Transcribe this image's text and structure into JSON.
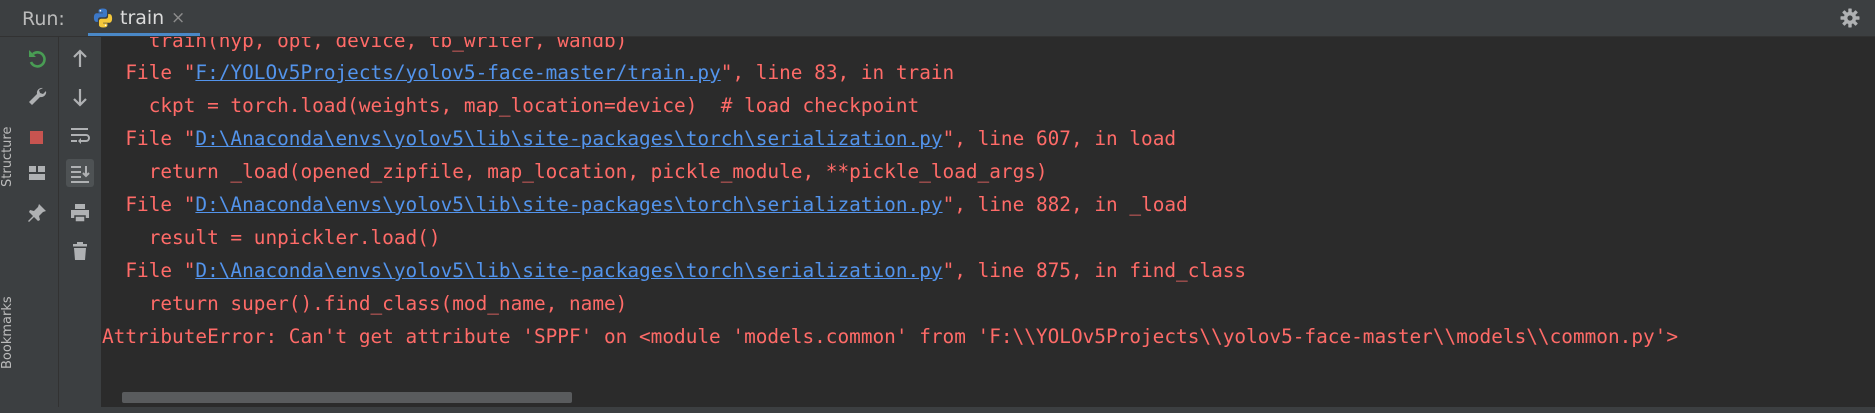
{
  "run_bar": {
    "label": "Run:",
    "tab_label": "train",
    "tab_close": "×"
  },
  "side_stripe": {
    "structure_label": "Structure",
    "bookmarks_label": "Bookmarks"
  },
  "colors": {
    "error_text": "#ff6b68",
    "link_text": "#5394ec",
    "background": "#2b2b2b",
    "panel": "#3c3f41",
    "tab_underline": "#4a88c7"
  },
  "console": {
    "lines": [
      {
        "pre": "    train(hyp, opt, device, tb_writer, wandb)",
        "link": "",
        "post": ""
      },
      {
        "pre": "  File \"",
        "link": "F:/YOLOv5Projects/yolov5-face-master/train.py",
        "post": "\", line 83, in train"
      },
      {
        "pre": "    ckpt = torch.load(weights, map_location=device)  # load checkpoint",
        "link": "",
        "post": ""
      },
      {
        "pre": "  File \"",
        "link": "D:\\Anaconda\\envs\\yolov5\\lib\\site-packages\\torch\\serialization.py",
        "post": "\", line 607, in load"
      },
      {
        "pre": "    return _load(opened_zipfile, map_location, pickle_module, **pickle_load_args)",
        "link": "",
        "post": ""
      },
      {
        "pre": "  File \"",
        "link": "D:\\Anaconda\\envs\\yolov5\\lib\\site-packages\\torch\\serialization.py",
        "post": "\", line 882, in _load"
      },
      {
        "pre": "    result = unpickler.load()",
        "link": "",
        "post": ""
      },
      {
        "pre": "  File \"",
        "link": "D:\\Anaconda\\envs\\yolov5\\lib\\site-packages\\torch\\serialization.py",
        "post": "\", line 875, in find_class"
      },
      {
        "pre": "    return super().find_class(mod_name, name)",
        "link": "",
        "post": ""
      },
      {
        "pre": "AttributeError: Can't get attribute 'SPPF' on <module 'models.common' from 'F:\\\\YOLOv5Projects\\\\yolov5-face-master\\\\models\\\\common.py'>",
        "link": "",
        "post": ""
      }
    ]
  }
}
